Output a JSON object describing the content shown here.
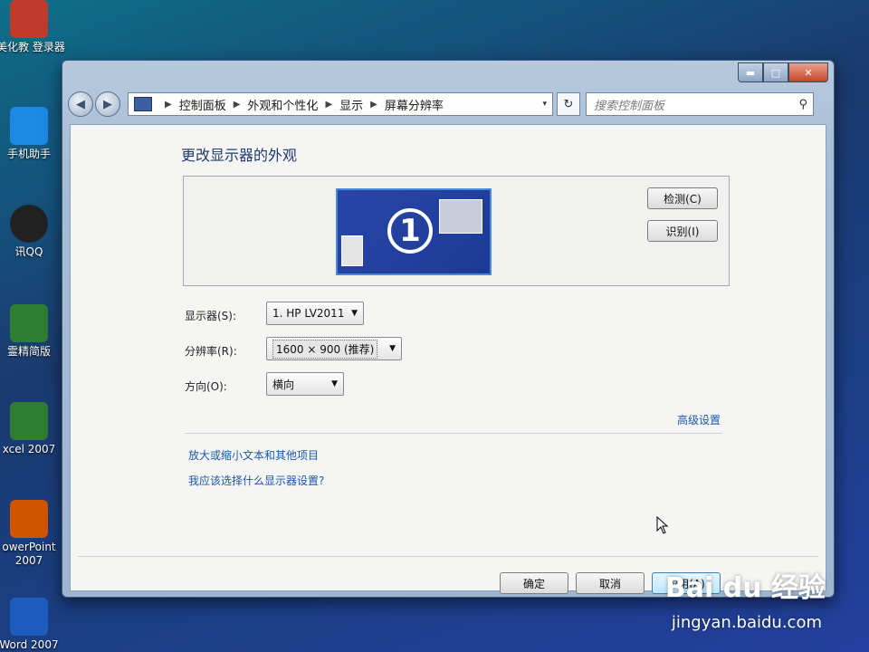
{
  "desktop": {
    "icons": [
      {
        "label": "美化教  登录器",
        "color": "#c0392b"
      },
      {
        "label": "手机助手",
        "color": "#1e88e5"
      },
      {
        "label": "讯QQ",
        "color": "#222"
      },
      {
        "label": "霊精简版",
        "color": "#2e7d32"
      },
      {
        "label": "xcel 2007",
        "color": "#2e7d32"
      },
      {
        "label": "owerPoint",
        "sub": "2007",
        "color": "#d35400"
      },
      {
        "label": "Word 2007",
        "color": "#1e5bbf"
      }
    ]
  },
  "window": {
    "controls": {
      "min": "▬",
      "max": "□",
      "close": "✕"
    }
  },
  "nav": {
    "back": "◀",
    "forward": "▶",
    "breadcrumbs": [
      "控制面板",
      "外观和个性化",
      "显示",
      "屏幕分辨率"
    ],
    "dropdown_glyph": "▾",
    "refresh_glyph": "↻",
    "search_placeholder": "搜索控制面板",
    "search_icon_glyph": "⚲"
  },
  "main": {
    "heading": "更改显示器的外观",
    "monitor_number": "1",
    "detect_button": "检测(C)",
    "identify_button": "识别(I)",
    "display_label": "显示器(S):",
    "display_value": "1. HP LV2011",
    "resolution_label": "分辨率(R):",
    "resolution_value": "1600 × 900 (推荐)",
    "orientation_label": "方向(O):",
    "orientation_value": "横向",
    "advanced_link": "高级设置",
    "link_text_size": "放大或缩小文本和其他项目",
    "link_help": "我应该选择什么显示器设置?"
  },
  "actions": {
    "ok": "确定",
    "cancel": "取消",
    "apply": "应用(A)"
  },
  "watermark": {
    "brand": "Bai du 经验",
    "url": "jingyan.baidu.com"
  }
}
